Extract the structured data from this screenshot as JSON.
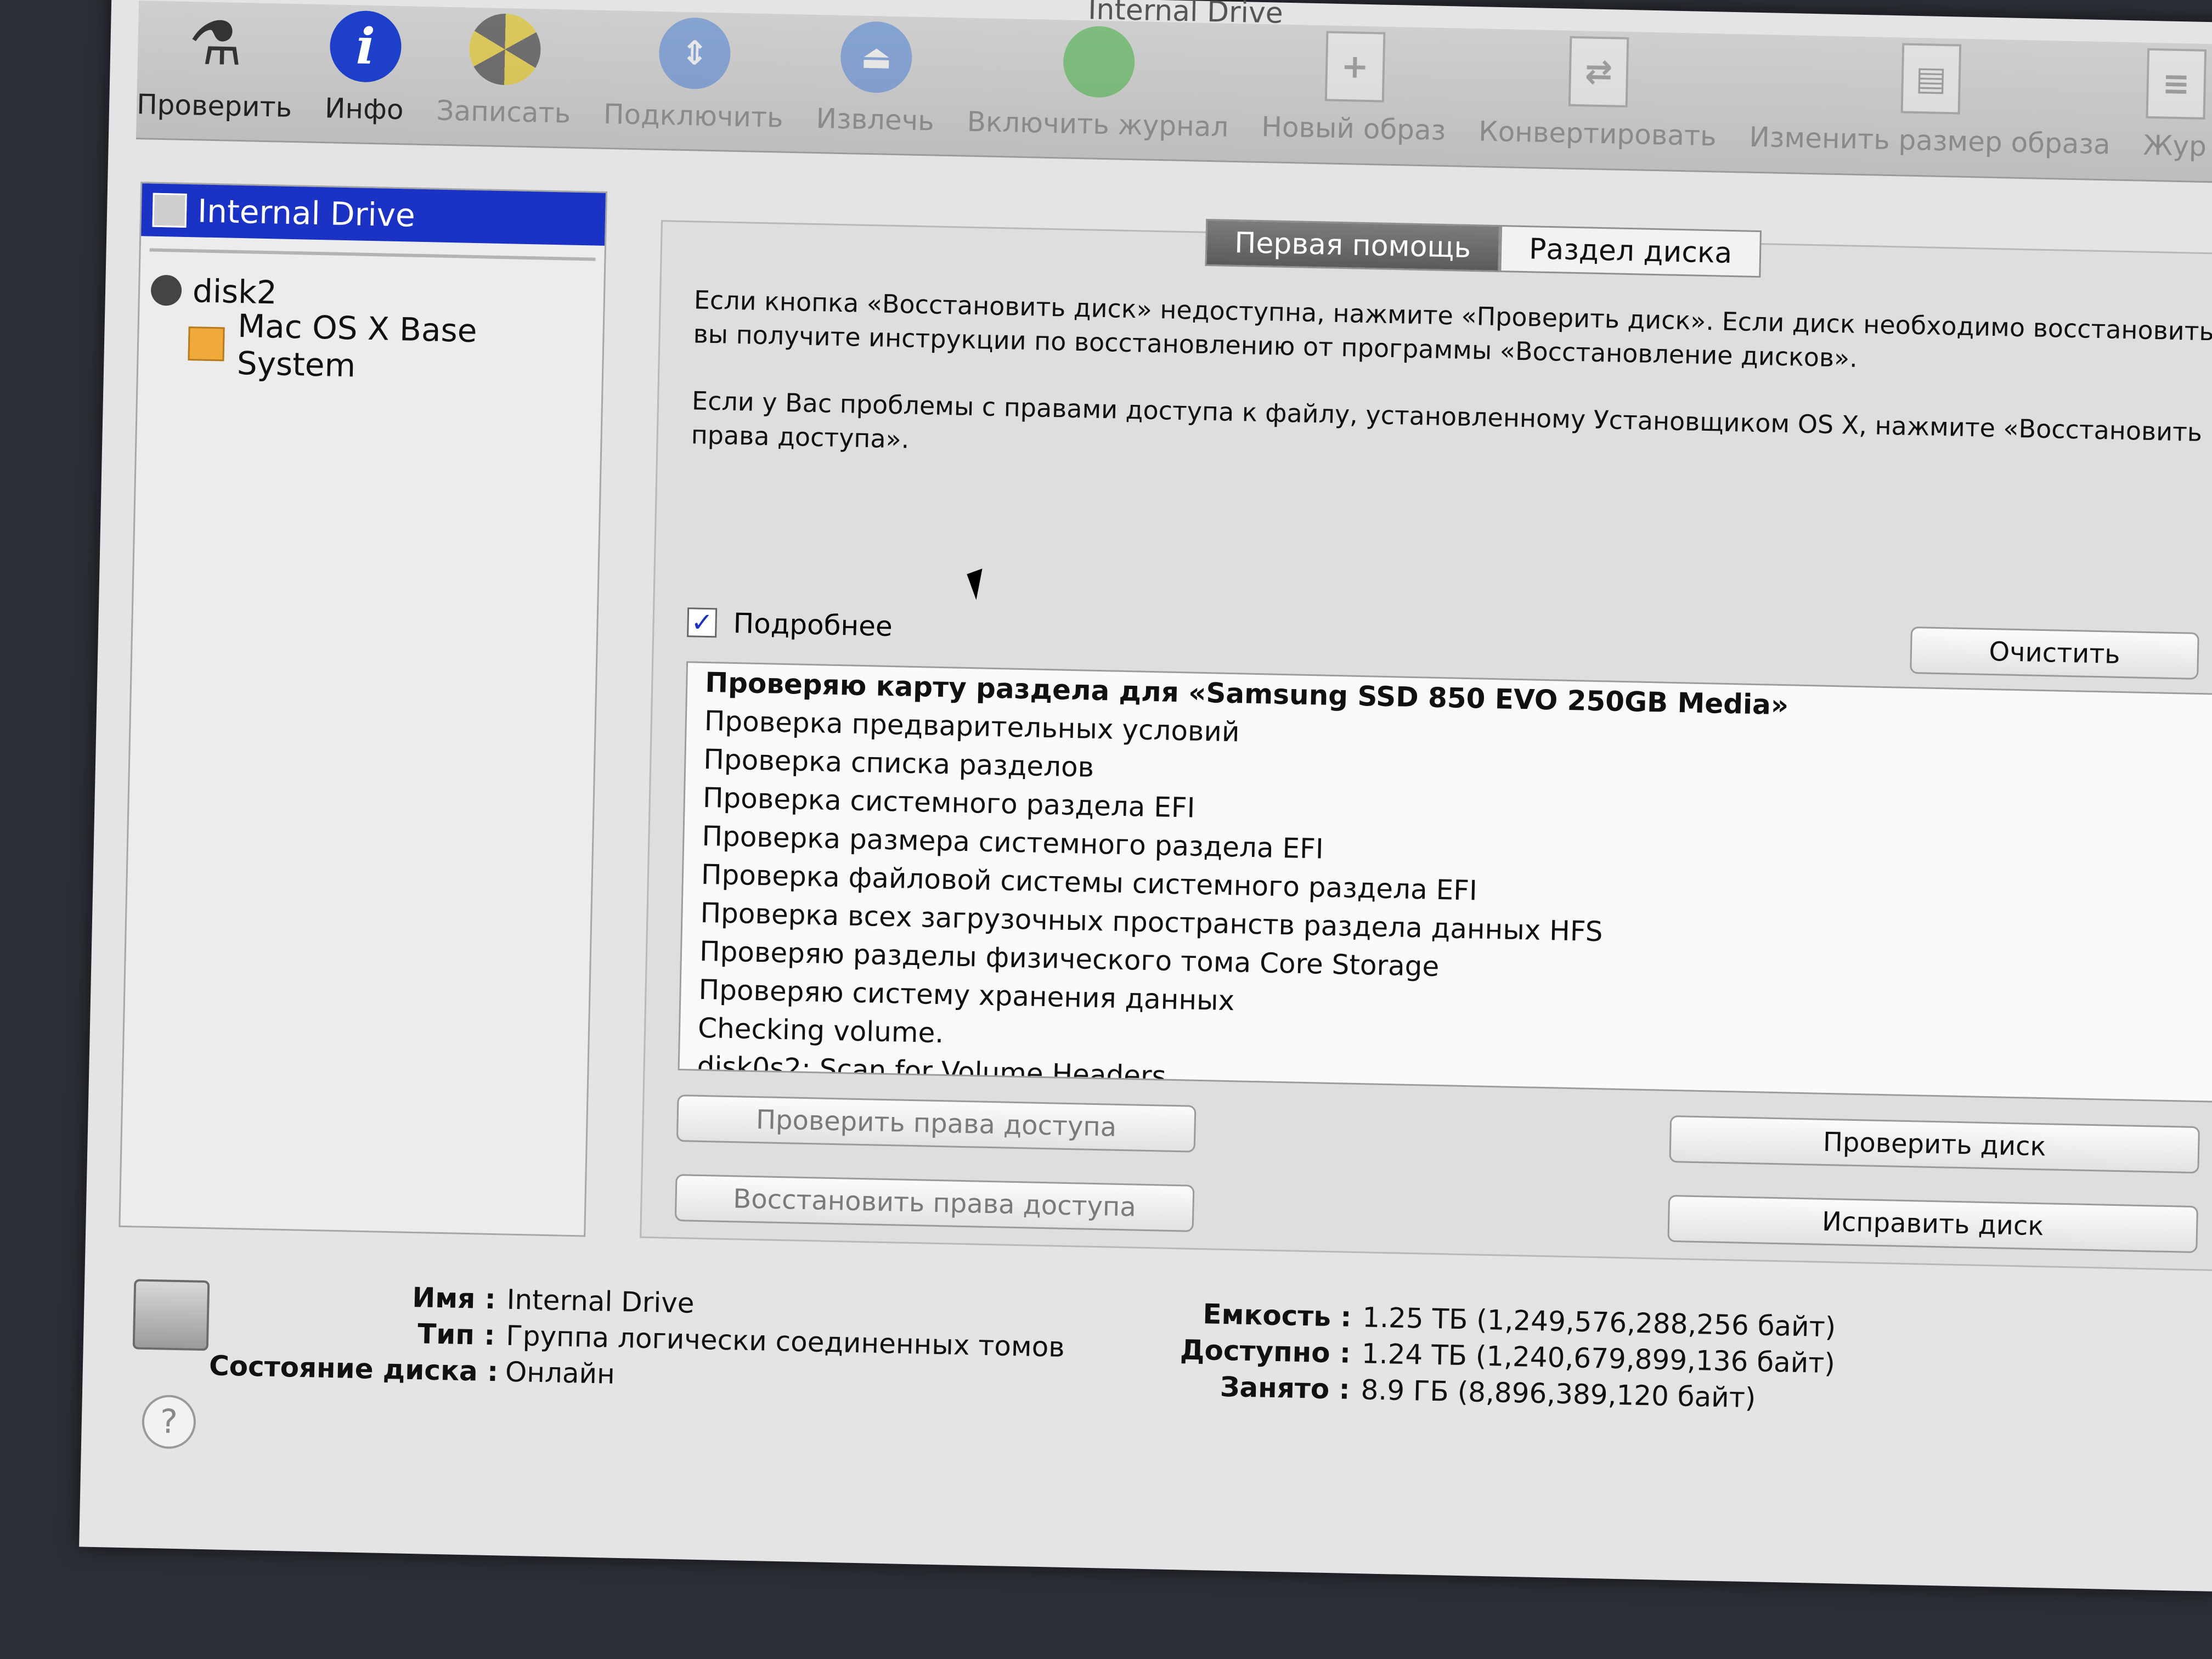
{
  "window": {
    "title": "Internal Drive"
  },
  "toolbar": {
    "items": [
      {
        "label": "Проверить",
        "icon": "microscope-icon",
        "enabled": true
      },
      {
        "label": "Инфо",
        "icon": "info-icon",
        "enabled": true
      },
      {
        "label": "Записать",
        "icon": "burn-icon",
        "enabled": false
      },
      {
        "label": "Подключить",
        "icon": "mount-icon",
        "enabled": false
      },
      {
        "label": "Извлечь",
        "icon": "eject-icon",
        "enabled": false
      },
      {
        "label": "Включить журнал",
        "icon": "journal-icon",
        "enabled": false
      },
      {
        "label": "Новый образ",
        "icon": "new-image-icon",
        "enabled": false
      },
      {
        "label": "Конвертировать",
        "icon": "convert-icon",
        "enabled": false
      },
      {
        "label": "Изменить размер образа",
        "icon": "resize-image-icon",
        "enabled": false
      },
      {
        "label": "Жур",
        "icon": "log-icon",
        "enabled": false
      }
    ]
  },
  "sidebar": {
    "items": [
      {
        "label": "Internal Drive",
        "selected": true
      },
      {
        "label": "disk2"
      },
      {
        "label": "Mac OS X Base System"
      }
    ]
  },
  "tabs": [
    {
      "label": "Первая помощь",
      "active": true
    },
    {
      "label": "Раздел диска",
      "active": false
    }
  ],
  "first_aid": {
    "paragraph1": "Если кнопка «Восстановить диск» недоступна, нажмите «Проверить диск». Если диск необходимо восстановить, вы получите инструкции по восстановлению от программы «Восстановление дисков».",
    "paragraph2": "Если у Вас проблемы с правами доступа к файлу, установленному Установщиком OS X, нажмите «Восстановить права доступа».",
    "details_label": "Подробнее",
    "details_checked": true,
    "clear_button": "Очистить",
    "log": [
      "Проверяю карту раздела для «Samsung SSD 850 EVO 250GB Media»",
      "Проверка предварительных условий",
      "Проверка списка разделов",
      "Проверка системного раздела EFI",
      "Проверка размера системного раздела EFI",
      "Проверка файловой системы системного раздела EFI",
      "Проверка всех загрузочных пространств раздела данных HFS",
      "Проверяю разделы физического тома Core Storage",
      "Проверяю систему хранения данных",
      "Checking volume.",
      "disk0s2: Scan for Volume Headers"
    ],
    "verify_permissions": "Проверить права доступа",
    "repair_permissions": "Восстановить права доступа",
    "verify_disk": "Проверить диск",
    "repair_disk": "Исправить диск"
  },
  "info": {
    "name_label": "Имя :",
    "name_value": "Internal Drive",
    "type_label": "Тип :",
    "type_value": "Группа логически соединенных томов",
    "status_label": "Состояние диска :",
    "status_value": "Онлайн",
    "capacity_label": "Емкость :",
    "capacity_value": "1.25 ТБ (1,249,576,288,256 байт)",
    "available_label": "Доступно :",
    "available_value": "1.24 ТБ (1,240,679,899,136 байт)",
    "used_label": "Занято :",
    "used_value": "8.9 ГБ (8,896,389,120 байт)"
  },
  "help_label": "?"
}
